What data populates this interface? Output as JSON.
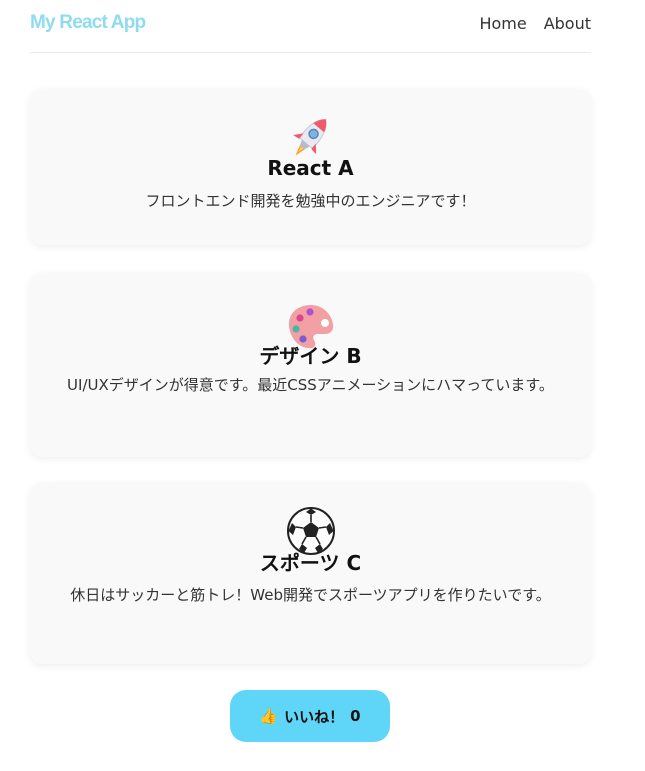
{
  "header": {
    "logo": "My React App",
    "nav": [
      {
        "label": "Home"
      },
      {
        "label": "About"
      }
    ]
  },
  "cards": [
    {
      "icon": "rocket-icon",
      "name": "React A",
      "description": "フロントエンド開発を勉強中のエンジニアです！"
    },
    {
      "icon": "palette-icon",
      "name": "デザイン B",
      "description": "UI/UXデザインが得意です。最近CSSアニメーションにハマっています。"
    },
    {
      "icon": "soccer-ball-icon",
      "name": "スポーツ C",
      "description": "休日はサッカーと筋トレ！Web開発でスポーツアプリを作りたいです。"
    }
  ],
  "like_button": {
    "icon": "thumbs-up-icon",
    "label": "いいね！",
    "count": "0"
  },
  "colors": {
    "logo": "#8fdcef",
    "button_bg": "#5fd6f7",
    "card_bg": "#f9f9f9"
  }
}
